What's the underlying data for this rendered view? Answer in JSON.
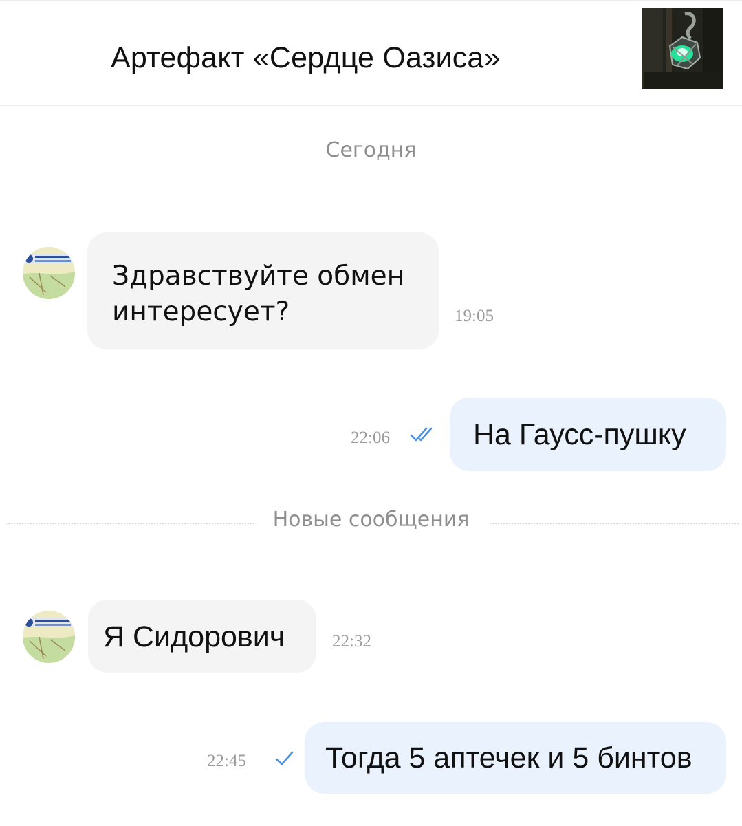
{
  "header": {
    "title": "Артефакт «Сердце Оазиса»",
    "thumbnail_icon": "artifact-thumbnail"
  },
  "date_separator": "Сегодня",
  "new_messages_separator": "Новые сообщения",
  "messages": [
    {
      "direction": "incoming",
      "text": "Здравствуйте обмен\nинтересует?",
      "time": "19:05"
    },
    {
      "direction": "outgoing",
      "text": "На Гаусс-пушку",
      "time": "22:06",
      "status": "read-double-check"
    },
    {
      "direction": "incoming",
      "text": "Я Сидорович",
      "time": "22:32"
    },
    {
      "direction": "outgoing",
      "text": "Тогда 5 аптечек и 5 бинтов",
      "time": "22:45",
      "status": "sent-single-check"
    }
  ],
  "colors": {
    "incoming_bubble": "#f4f4f5",
    "outgoing_bubble": "#eaf3fd",
    "check_blue": "#4a90e2",
    "meta_gray": "#9a9a9a"
  }
}
